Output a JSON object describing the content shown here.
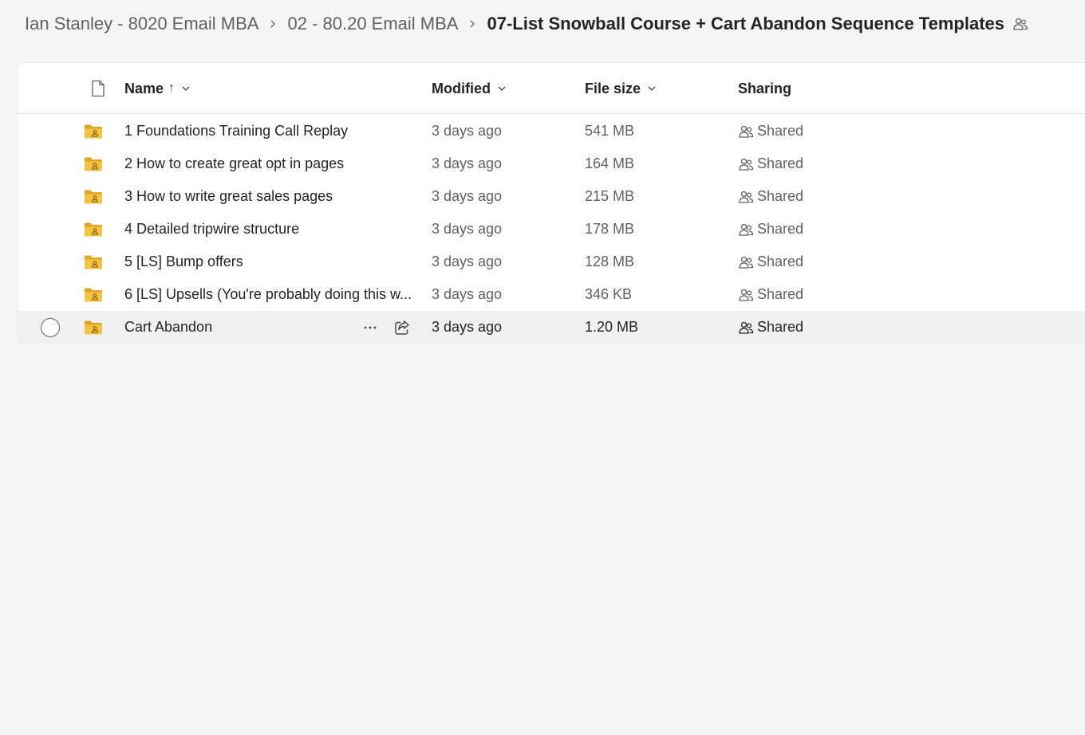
{
  "breadcrumb": {
    "items": [
      "Ian Stanley - 8020 Email MBA",
      "02 - 80.20 Email MBA"
    ],
    "current": "07-List Snowball Course + Cart Abandon Sequence Templates",
    "current_icon": "shared-people-icon"
  },
  "columns": {
    "name": "Name",
    "name_sort": "↑",
    "modified": "Modified",
    "file_size": "File size",
    "sharing": "Sharing"
  },
  "rows": [
    {
      "name": "1 Foundations Training Call Replay",
      "modified": "3 days ago",
      "size": "541 MB",
      "sharing": "Shared"
    },
    {
      "name": "2 How to create great opt in pages",
      "modified": "3 days ago",
      "size": "164 MB",
      "sharing": "Shared"
    },
    {
      "name": "3 How to write great sales pages",
      "modified": "3 days ago",
      "size": "215 MB",
      "sharing": "Shared"
    },
    {
      "name": "4 Detailed tripwire structure",
      "modified": "3 days ago",
      "size": "178 MB",
      "sharing": "Shared"
    },
    {
      "name": "5 [LS] Bump offers",
      "modified": "3 days ago",
      "size": "128 MB",
      "sharing": "Shared"
    },
    {
      "name": "6 [LS] Upsells (You're probably doing this w...",
      "modified": "3 days ago",
      "size": "346 KB",
      "sharing": "Shared"
    },
    {
      "name": "Cart Abandon",
      "modified": "3 days ago",
      "size": "1.20 MB",
      "sharing": "Shared"
    }
  ],
  "colors": {
    "folder": "#f5c242",
    "folder_dark": "#e0a526",
    "hover_row": "#f0f0f0"
  }
}
